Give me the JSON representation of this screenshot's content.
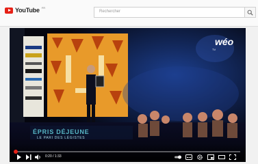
{
  "site": {
    "logo_text": "YouTube",
    "logo_sup": "FR",
    "search_placeholder": "Rechercher"
  },
  "video": {
    "overlay_title": "ÉPRIS DÉJEUNE",
    "overlay_subtitle": "LE PARI DES LÉGISTES",
    "brand": "wéo",
    "brand_sub": "TV",
    "time_display": "0:20 / 1:33",
    "progress_fraction": 0.005
  },
  "colors": {
    "accent": "#e62117",
    "teal": "#60c8d6",
    "stage_orange": "#e89a2a"
  }
}
